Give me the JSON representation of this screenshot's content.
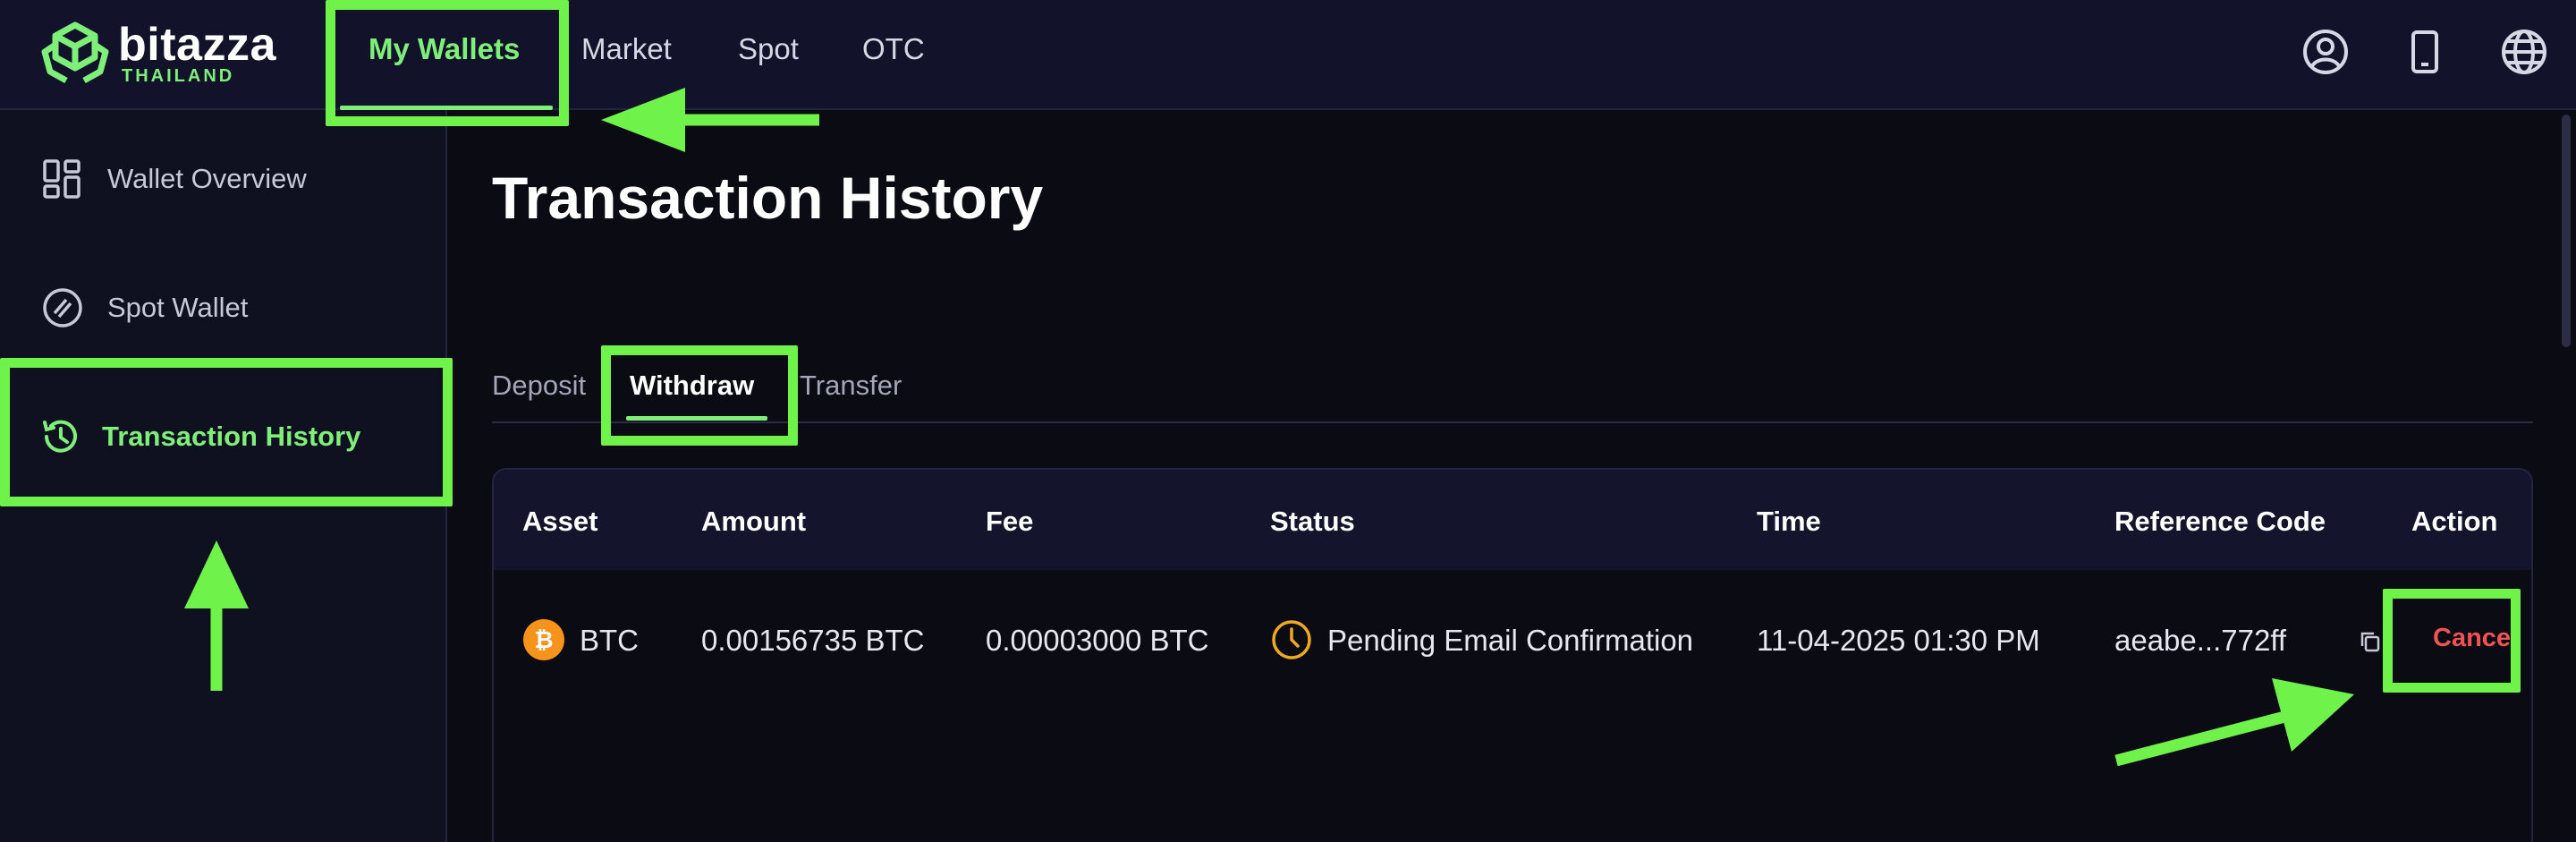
{
  "brand": {
    "name": "bitazza",
    "sub": "THAILAND",
    "accent": "#7ef07a"
  },
  "nav": {
    "items": [
      {
        "label": "My Wallets",
        "active": true
      },
      {
        "label": "Market"
      },
      {
        "label": "Spot"
      },
      {
        "label": "OTC"
      }
    ],
    "icons": [
      "user-circle-icon",
      "phone-icon",
      "globe-icon"
    ]
  },
  "sidebar": {
    "items": [
      {
        "label": "Wallet Overview",
        "icon": "grid-icon"
      },
      {
        "label": "Spot Wallet",
        "icon": "slashed-circle-icon"
      },
      {
        "label": "Transaction History",
        "icon": "history-icon",
        "active": true
      }
    ]
  },
  "page": {
    "title": "Transaction History"
  },
  "tabs": [
    {
      "label": "Deposit"
    },
    {
      "label": "Withdraw",
      "active": true
    },
    {
      "label": "Transfer"
    }
  ],
  "table": {
    "headers": [
      "Asset",
      "Amount",
      "Fee",
      "Status",
      "Time",
      "Reference Code",
      "Action"
    ],
    "rows": [
      {
        "asset": "BTC",
        "amount": "0.00156735 BTC",
        "fee": "0.00003000 BTC",
        "status": "Pending Email Confirmation",
        "time": "11-04-2025 01:30 PM",
        "reference": "aeabe...772ff",
        "action": "Cancel"
      }
    ]
  },
  "colors": {
    "annotation": "#6ff24a",
    "cancel": "#f05353",
    "pending": "#f0a81f",
    "btc": "#f7931a"
  }
}
